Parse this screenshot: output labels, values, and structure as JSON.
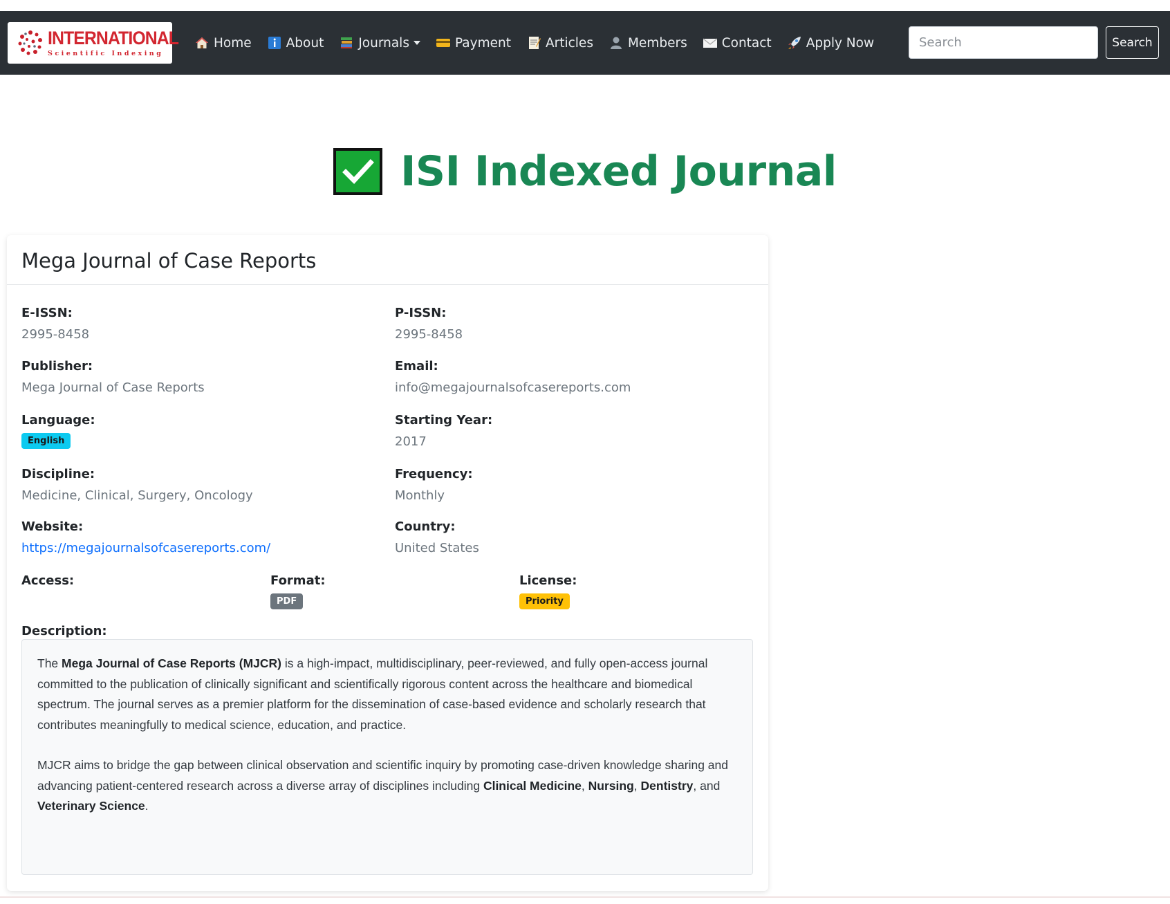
{
  "navbar": {
    "logo": {
      "main": "INTERNATIONAL",
      "sub": "Scientific Indexing"
    },
    "items": [
      {
        "label": "Home",
        "icon": "house-icon"
      },
      {
        "label": "About",
        "icon": "info-icon"
      },
      {
        "label": "Journals",
        "icon": "books-icon",
        "dropdown": true
      },
      {
        "label": "Payment",
        "icon": "credit-card-icon"
      },
      {
        "label": "Articles",
        "icon": "memo-icon"
      },
      {
        "label": "Members",
        "icon": "person-icon"
      },
      {
        "label": "Contact",
        "icon": "envelope-icon"
      },
      {
        "label": "Apply Now",
        "icon": "rocket-icon"
      }
    ],
    "search": {
      "placeholder": "Search",
      "button_label": "Search"
    }
  },
  "hero": {
    "title": "ISI Indexed Journal",
    "icon": "check-box-icon"
  },
  "journal": {
    "name": "Mega Journal of Case Reports",
    "e_issn": {
      "label": "E-ISSN:",
      "value": "2995-8458"
    },
    "p_issn": {
      "label": "P-ISSN:",
      "value": "2995-8458"
    },
    "publisher": {
      "label": "Publisher:",
      "value": "Mega Journal of Case Reports"
    },
    "email": {
      "label": "Email:",
      "value": "info@megajournalsofcasereports.com"
    },
    "language": {
      "label": "Language:",
      "value": "English"
    },
    "starting_year": {
      "label": "Starting Year:",
      "value": "2017"
    },
    "discipline": {
      "label": "Discipline:",
      "value": "Medicine, Clinical, Surgery, Oncology"
    },
    "frequency": {
      "label": "Frequency:",
      "value": "Monthly"
    },
    "website": {
      "label": "Website:",
      "value": "https://megajournalsofcasereports.com/"
    },
    "country": {
      "label": "Country:",
      "value": "United States"
    },
    "access": {
      "label": "Access:"
    },
    "format": {
      "label": "Format:",
      "value": "PDF"
    },
    "license": {
      "label": "License:",
      "value": "Priority"
    },
    "description": {
      "label": "Description:",
      "p1": {
        "pre": "The ",
        "bold": "Mega Journal of Case Reports (MJCR)",
        "post": " is a high-impact, multidisciplinary, peer-reviewed, and fully open-access journal committed to the publication of clinically significant and scientifically rigorous content across the healthcare and biomedical spectrum. The journal serves as a premier platform for the dissemination of case-based evidence and scholarly research that contributes meaningfully to medical science, education, and practice."
      },
      "p2": {
        "pre": "MJCR aims to bridge the gap between clinical observation and scientific inquiry by promoting case-driven knowledge sharing and advancing patient-centered research across a diverse array of disciplines including ",
        "b1": "Clinical Medicine",
        "s1": ", ",
        "b2": "Nursing",
        "s2": ", ",
        "b3": "Dentistry",
        "s3": ", and ",
        "b4": "Veterinary Science",
        "end": "."
      }
    }
  },
  "colors": {
    "navbar": "#2b3035",
    "hero_title": "#198754",
    "link": "#0d6efd",
    "badge_language": "#0dcaf0",
    "badge_format": "#6c757d",
    "badge_license": "#ffc107"
  }
}
